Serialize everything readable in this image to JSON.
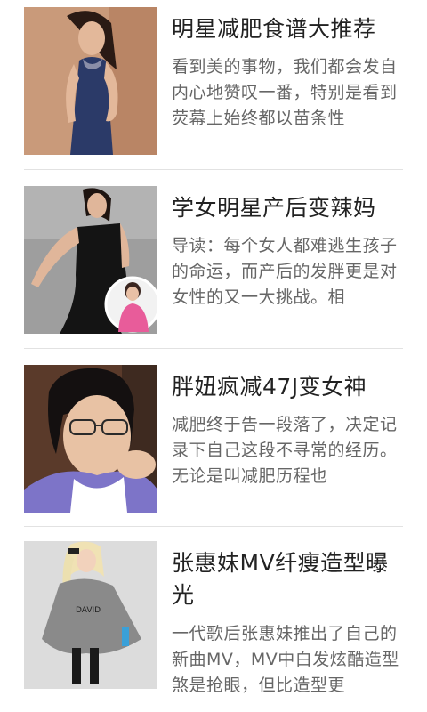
{
  "articles": [
    {
      "title": "明星减肥食谱大推荐",
      "summary": "看到美的事物，我们都会发自内心地赞叹一番，特别是看到荧幕上始终都以苗条性",
      "thumbnail_icon": "woman-navy-dress-photo"
    },
    {
      "title": "学女明星产后变辣妈",
      "summary": "导读：每个女人都难逃生孩子的命运，而产后的发胖更是对女性的又一大挑战。相",
      "thumbnail_icon": "woman-black-dress-photo"
    },
    {
      "title": "胖妞疯减47J变女神",
      "summary": "减肥终于告一段落了，决定记录下自己这段不寻常的经历。无论是叫减肥历程也",
      "thumbnail_icon": "girl-glasses-photo"
    },
    {
      "title": "张惠妹MV纤瘦造型曝光",
      "summary": "一代歌后张惠妹推出了自己的新曲MV，MV中白发炫酷造型煞是抢眼，但比造型更",
      "thumbnail_icon": "singer-blonde-photo"
    }
  ]
}
